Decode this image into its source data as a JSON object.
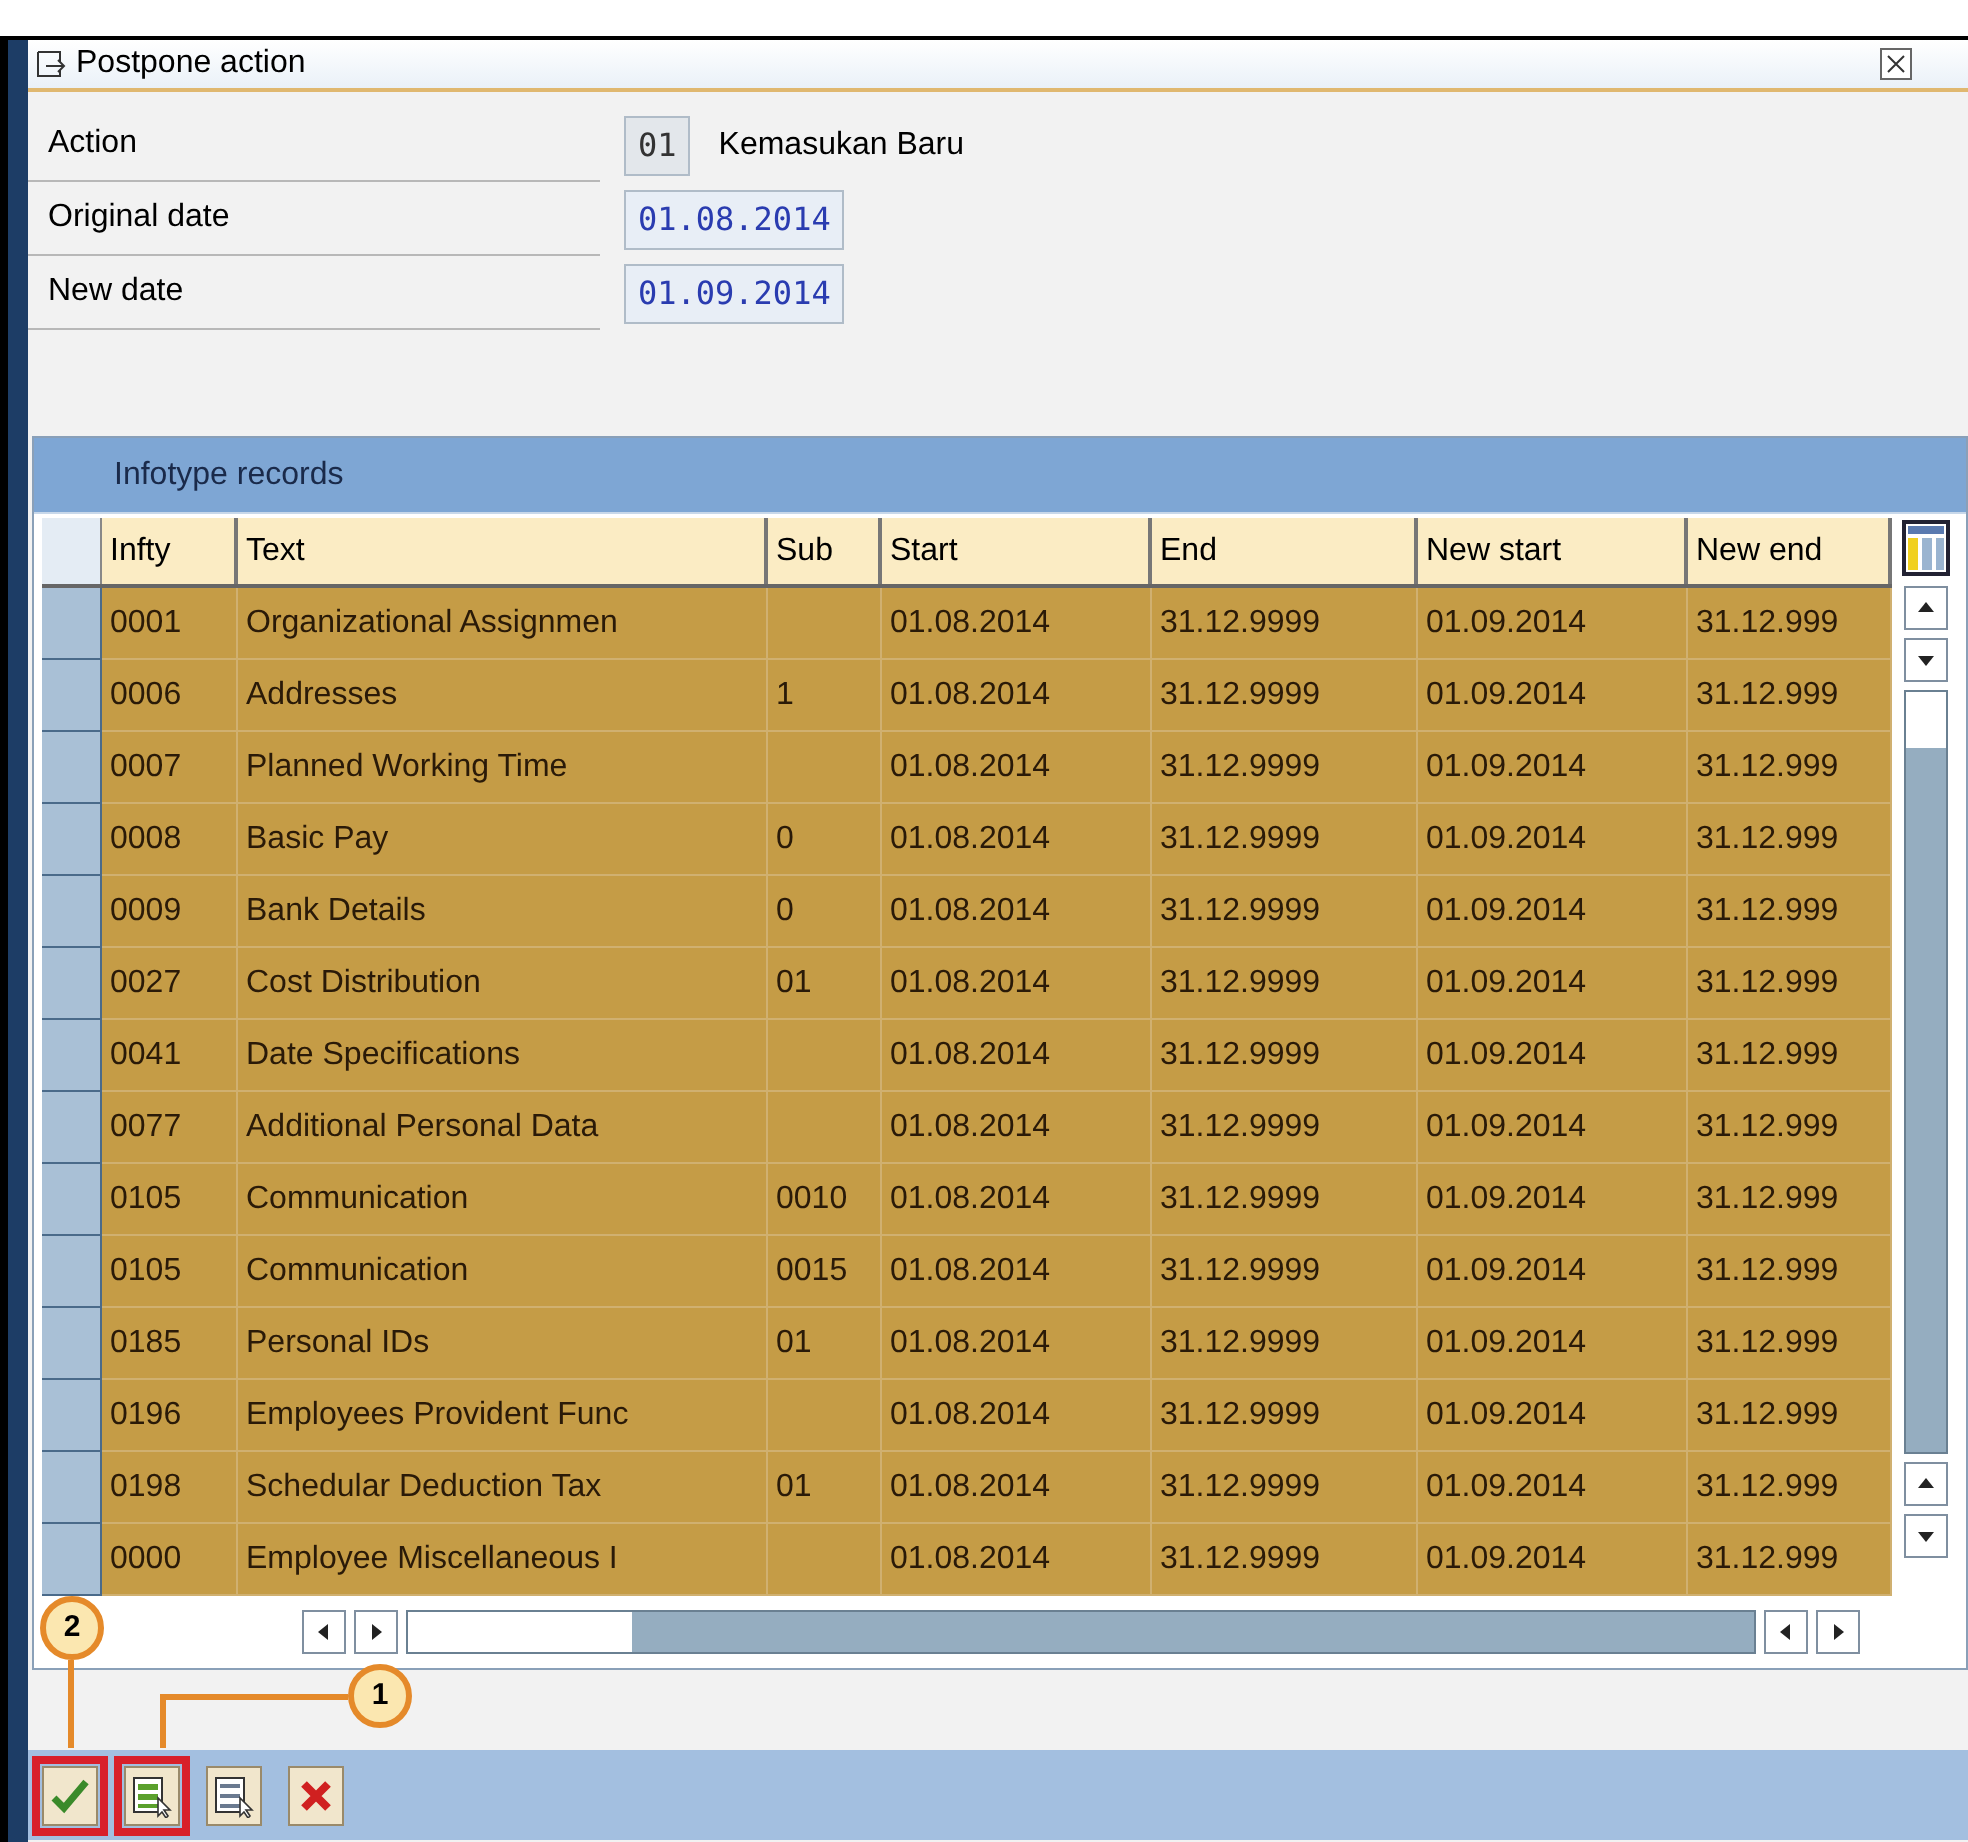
{
  "window": {
    "title": "Postpone action"
  },
  "fields": [
    {
      "label": "Action",
      "value": "01",
      "kind": "code",
      "description": "Kemasukan Baru"
    },
    {
      "label": "Original date",
      "value": "01.08.2014",
      "kind": "date"
    },
    {
      "label": "New date",
      "value": "01.09.2014",
      "kind": "date"
    }
  ],
  "table": {
    "title": "Infotype records",
    "columns": [
      "Infty",
      "Text",
      "Sub",
      "Start",
      "End",
      "New start",
      "New end"
    ],
    "rows": [
      {
        "selected": true,
        "cells": [
          "0001",
          "Organizational Assignmen",
          "",
          "01.08.2014",
          "31.12.9999",
          "01.09.2014",
          "31.12.999"
        ]
      },
      {
        "selected": true,
        "cells": [
          "0006",
          "Addresses",
          "1",
          "01.08.2014",
          "31.12.9999",
          "01.09.2014",
          "31.12.999"
        ]
      },
      {
        "selected": true,
        "cells": [
          "0007",
          "Planned Working Time",
          "",
          "01.08.2014",
          "31.12.9999",
          "01.09.2014",
          "31.12.999"
        ]
      },
      {
        "selected": true,
        "cells": [
          "0008",
          "Basic Pay",
          "0",
          "01.08.2014",
          "31.12.9999",
          "01.09.2014",
          "31.12.999"
        ]
      },
      {
        "selected": true,
        "cells": [
          "0009",
          "Bank Details",
          "0",
          "01.08.2014",
          "31.12.9999",
          "01.09.2014",
          "31.12.999"
        ]
      },
      {
        "selected": true,
        "cells": [
          "0027",
          "Cost Distribution",
          "01",
          "01.08.2014",
          "31.12.9999",
          "01.09.2014",
          "31.12.999"
        ]
      },
      {
        "selected": true,
        "cells": [
          "0041",
          "Date Specifications",
          "",
          "01.08.2014",
          "31.12.9999",
          "01.09.2014",
          "31.12.999"
        ]
      },
      {
        "selected": true,
        "cells": [
          "0077",
          "Additional Personal Data",
          "",
          "01.08.2014",
          "31.12.9999",
          "01.09.2014",
          "31.12.999"
        ]
      },
      {
        "selected": true,
        "cells": [
          "0105",
          "Communication",
          "0010",
          "01.08.2014",
          "31.12.9999",
          "01.09.2014",
          "31.12.999"
        ]
      },
      {
        "selected": true,
        "cells": [
          "0105",
          "Communication",
          "0015",
          "01.08.2014",
          "31.12.9999",
          "01.09.2014",
          "31.12.999"
        ]
      },
      {
        "selected": true,
        "cells": [
          "0185",
          "Personal IDs",
          "01",
          "01.08.2014",
          "31.12.9999",
          "01.09.2014",
          "31.12.999"
        ]
      },
      {
        "selected": true,
        "cells": [
          "0196",
          "Employees Provident Func",
          "",
          "01.08.2014",
          "31.12.9999",
          "01.09.2014",
          "31.12.999"
        ]
      },
      {
        "selected": true,
        "cells": [
          "0198",
          "Schedular Deduction Tax",
          "01",
          "01.08.2014",
          "31.12.9999",
          "01.09.2014",
          "31.12.999"
        ]
      },
      {
        "selected": true,
        "cells": [
          "0000",
          "Employee Miscellaneous I",
          "",
          "01.08.2014",
          "31.12.9999",
          "01.09.2014",
          "31.12.999"
        ]
      }
    ]
  },
  "buttons": [
    {
      "kind": "confirm",
      "highlighted": true,
      "callout": "2"
    },
    {
      "kind": "select-all",
      "highlighted": true,
      "callout": "1"
    },
    {
      "kind": "deselect-all",
      "highlighted": false
    },
    {
      "kind": "cancel",
      "highlighted": false
    }
  ]
}
